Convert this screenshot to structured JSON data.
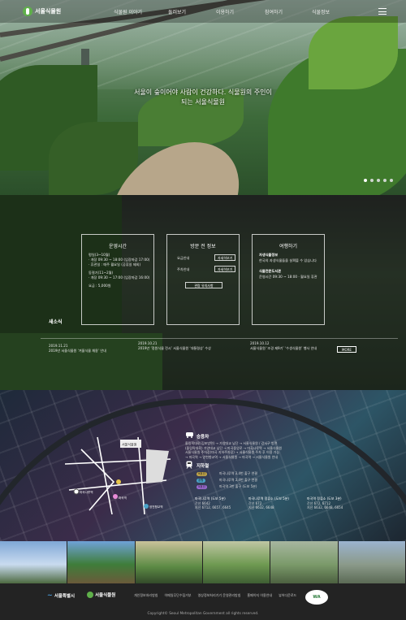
{
  "header": {
    "logo_text": "서울식물원",
    "nav": [
      "식물원 이야기",
      "둘러보기",
      "이용하기",
      "참여하기",
      "식물정보"
    ]
  },
  "hero": {
    "title_line1": "서울이 숲이어야 사람이 건강하다. 식물원의 주인이",
    "title_line2": "되는 서울식물원",
    "slide_count": 5
  },
  "info": {
    "hours": {
      "title": "운영시간",
      "lines": [
        "평일(3~10월)",
        "· 개장 09:30 ~ 18:00 (입장마감 17:00)",
        "· 휴관일 : 매주 월요일 (공휴일 제외)",
        "동절기(11~2월)",
        "· 개장 09:30 ~ 17:00 (입장마감 16:00)"
      ],
      "fee": "요금 : 5,000원"
    },
    "visit": {
      "title": "방문 전 정보",
      "items": [
        "요금안내",
        "주차안내"
      ],
      "item_button": "자세히보기",
      "button": "관람 유의사항"
    },
    "learn": {
      "title": "여행하기",
      "b1": "자생식물정보",
      "t1": "한국의 자생식물들을 살펴볼 수 있습니다",
      "b2": "식물전문도서관",
      "t2": "운영시간 09:30 ~ 18:00 · 월요일 휴관"
    },
    "news": {
      "title": "새소식",
      "items": [
        {
          "date": "2019.11.21",
          "text": "2019년 서울식물원 ‘겨울식물 채용’ 안내"
        },
        {
          "date": "2019.10.21",
          "text": "2019년 ‘정원식물 전시’ 서울식물원 ‘대통령상’ 수상"
        },
        {
          "date": "2019.10.12",
          "text": "서울식물원 ‘조경 제9기’ ‘수생식물원’ 행사 안내"
        }
      ],
      "more": "MORE"
    }
  },
  "directions": {
    "transit_title": "승용차",
    "transit_lines": [
      "올림픽대로(김포방면) → 가양대교 남단 → 서울식물원 / 강서구 방면",
      "(올림픽대로) 가양대교 남단 → 마곡중앙로 → 마곡나루역 → 서울식물원",
      "서울식물원 주차장(마곡 지하주차장) → 서울식물원 주차 후 이용 가능",
      "→ 마곡역 → 양천향교역 → 서울식물원 → 마곡역 → 서울식물원 안내"
    ],
    "subway_title": "지하철",
    "subway": [
      {
        "tag": "9호선",
        "color": "#bfa44a",
        "text": "마곡나루역 3,4번 출구 연결"
      },
      {
        "tag": "공항",
        "color": "#4aa3c8",
        "text": "마곡나루역 3,4번 출구 연결"
      },
      {
        "tag": "5호선",
        "color": "#9a6ad0",
        "text": "마곡역 3번 출구 (도보 5분)"
      }
    ],
    "bus_stops": [
      {
        "title": "마곡나루역 (도보 5분)",
        "lines": [
          "간선 6642",
          "지선 6712, 6657, 6645"
        ]
      },
      {
        "title": "마곡나루역 정류소 (도보 5분)",
        "lines": [
          "간선 672",
          "지선 6632, 6648"
        ]
      },
      {
        "title": "마곡역 정류소 (도보 3분)",
        "lines": [
          "간선 672, 6712",
          "지선 6632, 6648, 6654"
        ]
      }
    ],
    "map_labels": [
      "서울식물원",
      "마곡나루역",
      "마곡역",
      "양천향교역"
    ]
  },
  "footer": {
    "logo1": "서울특별시",
    "logo2": "서울식물원",
    "links": [
      "개인정보처리방침",
      "이메일무단수집거부",
      "영상정보처리기기 운영관리방침",
      "홈페이지 이용안내",
      "뷰어다운로드"
    ],
    "copyright": "Copyright© Seoul Metropolitan Government all rights reserved.",
    "badge": "WA"
  },
  "colors": {
    "brand_green": "#5fb04a",
    "badge_green": "#2a7a3a"
  }
}
